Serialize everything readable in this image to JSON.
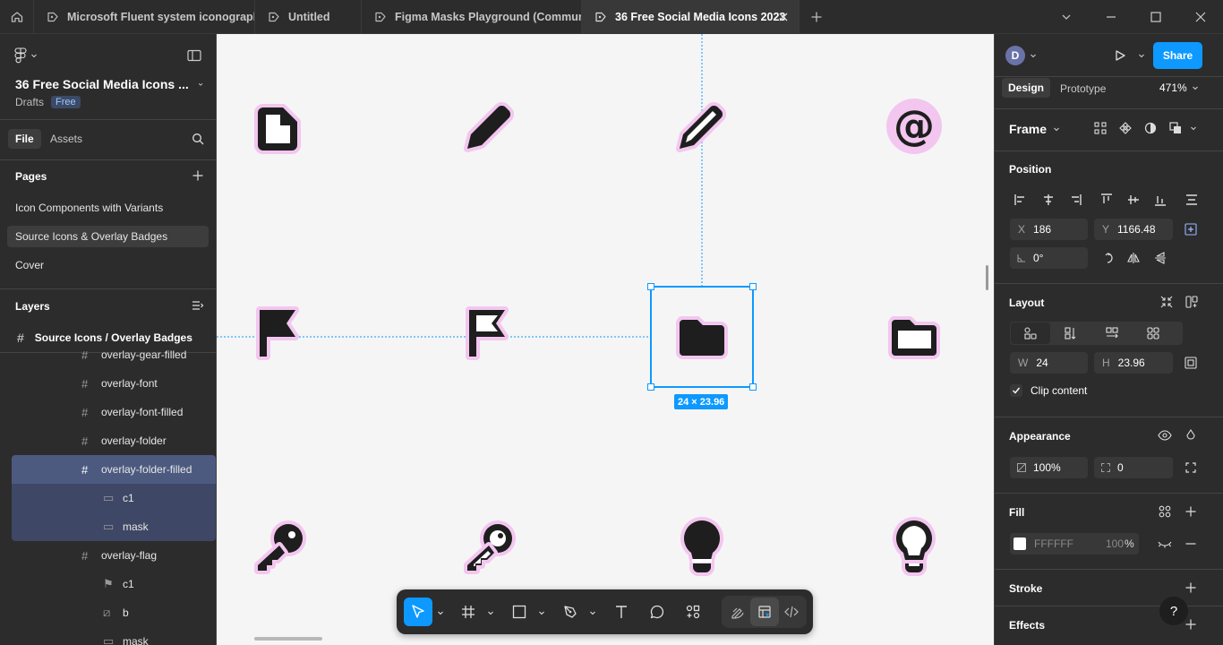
{
  "tabs": [
    {
      "label": "Microsoft Fluent system iconography"
    },
    {
      "label": "Untitled"
    },
    {
      "label": "Figma Masks Playground (Community)"
    },
    {
      "label": "36 Free Social Media Icons 2023"
    }
  ],
  "file": {
    "name": "36 Free Social Media Icons ...",
    "location": "Drafts",
    "badge": "Free"
  },
  "left_tabs": {
    "file": "File",
    "assets": "Assets"
  },
  "pages": {
    "title": "Pages",
    "items": [
      "Icon Components with Variants",
      "Source Icons & Overlay Badges",
      "Cover"
    ]
  },
  "layers": {
    "title": "Layers",
    "frame": "Source Icons / Overlay Badges",
    "items": [
      "overlay-gear-filled",
      "overlay-font",
      "overlay-font-filled",
      "overlay-folder",
      "overlay-folder-filled",
      "c1",
      "mask",
      "overlay-flag",
      "c1",
      "b",
      "mask"
    ]
  },
  "canvas": {
    "selection_size": "24 × 23.96",
    "icons": [
      "document-icon",
      "pencil-filled-icon",
      "pencil-outline-icon",
      "at-sign-icon",
      "flag-filled-icon",
      "flag-outline-icon",
      "folder-filled-icon",
      "folder-outline-icon",
      "key-filled-icon",
      "key-outline-icon",
      "lightbulb-filled-icon",
      "lightbulb-outline-icon"
    ]
  },
  "right": {
    "avatar": "D",
    "share": "Share",
    "design_tab": "Design",
    "prototype_tab": "Prototype",
    "zoom": "471%",
    "frame_label": "Frame",
    "position_title": "Position",
    "x_label": "X",
    "x_value": "186",
    "y_label": "Y",
    "y_value": "1166.48",
    "rotation": "0°",
    "layout_title": "Layout",
    "w_label": "W",
    "w_value": "24",
    "h_label": "H",
    "h_value": "23.96",
    "clip_content": "Clip content",
    "appearance_title": "Appearance",
    "opacity": "100%",
    "radius": "0",
    "fill_title": "Fill",
    "fill_hex": "FFFFFF",
    "fill_opacity": "100",
    "fill_pct": "%",
    "stroke_title": "Stroke",
    "effects_title": "Effects",
    "help": "?"
  },
  "colors": {
    "accent": "#0d99ff",
    "selection_layer": "#4d5a80",
    "icon_glow": "#f3c6ef",
    "icon_dark": "#1e1e1e"
  }
}
